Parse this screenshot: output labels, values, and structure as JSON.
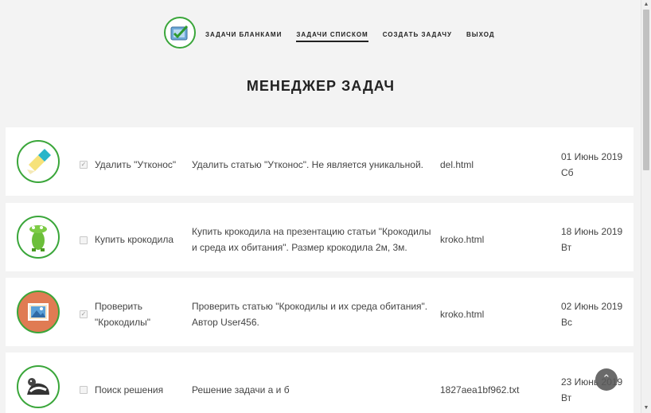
{
  "nav": {
    "items": [
      {
        "label": "ЗАДАЧИ БЛАНКАМИ",
        "active": false
      },
      {
        "label": "ЗАДАЧИ СПИСКОМ",
        "active": true
      },
      {
        "label": "СОЗДАТЬ ЗАДАЧУ",
        "active": false
      },
      {
        "label": "ВЫХОД",
        "active": false
      }
    ]
  },
  "page_title": "МЕНЕДЖЕР ЗАДАЧ",
  "tasks": [
    {
      "icon": "eraser-icon",
      "checked": true,
      "name": "Удалить \"Утконос\"",
      "description": "Удалить статью \"Утконос\". Не является уникальной.",
      "file": "del.html",
      "date": "01 Июнь 2019",
      "weekday": "Сб"
    },
    {
      "icon": "crocodile-icon",
      "checked": false,
      "name": "Купить крокодила",
      "description": "Купить крокодила на презентацию статьи \"Крокодилы и среда их обитания\". Размер крокодила 2м, 3м.",
      "file": "kroko.html",
      "date": "18 Июнь 2019",
      "weekday": "Вт"
    },
    {
      "icon": "picture-icon",
      "checked": true,
      "name": "Проверить \"Крокодилы\"",
      "description": "Проверить статью \"Крокодилы и их среда обитания\". Автор User456.",
      "file": "kroko.html",
      "date": "02 Июнь 2019",
      "weekday": "Вс"
    },
    {
      "icon": "skunk-icon",
      "checked": false,
      "name": "Поиск решения",
      "description": "Решение задачи а и б",
      "file": "1827aea1bf962.txt",
      "date": "23 Июнь 2019",
      "weekday": "Вт"
    }
  ],
  "scroll_top_label": "⌃",
  "colors": {
    "accent": "#3aa63a",
    "background": "#f3f3f3",
    "card": "#ffffff"
  }
}
